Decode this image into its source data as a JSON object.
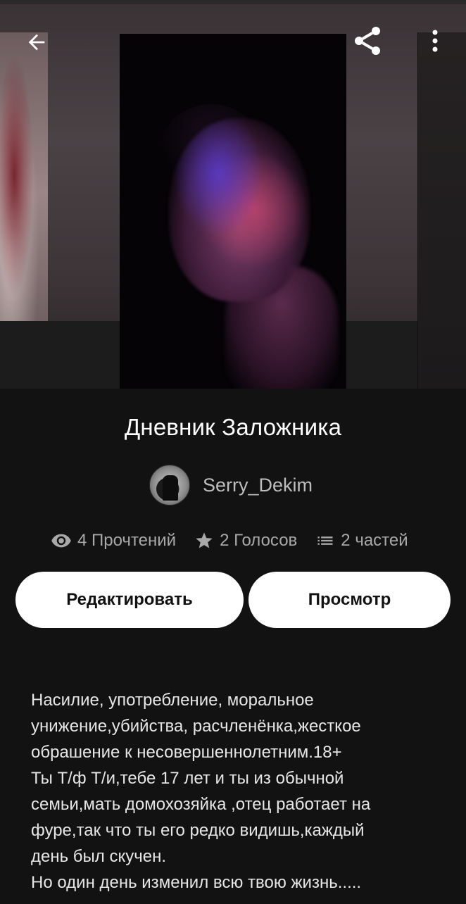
{
  "header": {
    "back_icon": "back-arrow-icon",
    "share_icon": "share-icon",
    "more_icon": "more-vertical-icon"
  },
  "story": {
    "title": "Дневник Заложника",
    "author": "Serry_Dekim",
    "stats": {
      "reads": "4 Прочтений",
      "votes": "2 Голосов",
      "parts": "2 частей"
    },
    "edit_label": "Редактировать",
    "preview_label": "Просмотр",
    "description": "Насилие, употребление, моральное\nунижение,убийства, расчленёнка,жесткое\nобрашение к несовершеннолетним.18+\nТы Т/ф Т/и,тебе 17 лет и ты из обычной\nсемьи,мать домохозяйка ,отец работает на\nфуре,так что ты его редко видишь,каждый\nдень был скучен.\nНо один день изменил всю твою жизнь....."
  },
  "colors": {
    "background": "#121212",
    "button_bg": "#ffffff",
    "stat_text": "#a8a8a8"
  }
}
